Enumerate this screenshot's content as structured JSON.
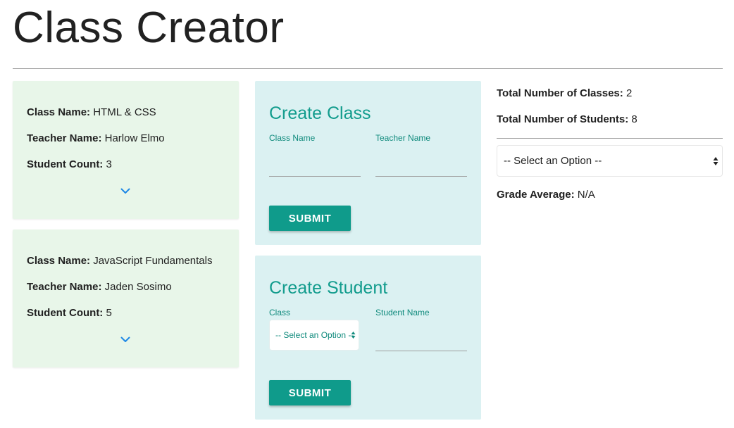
{
  "page": {
    "title": "Class Creator"
  },
  "classes": [
    {
      "name_label": "Class Name:",
      "name": "HTML & CSS",
      "teacher_label": "Teacher Name:",
      "teacher": "Harlow Elmo",
      "count_label": "Student Count:",
      "count": "3"
    },
    {
      "name_label": "Class Name:",
      "name": "JavaScript Fundamentals",
      "teacher_label": "Teacher Name:",
      "teacher": "Jaden Sosimo",
      "count_label": "Student Count:",
      "count": "5"
    }
  ],
  "create_class": {
    "title": "Create Class",
    "class_name_label": "Class Name",
    "class_name_value": "",
    "teacher_name_label": "Teacher Name",
    "teacher_name_value": "",
    "submit_label": "SUBMIT"
  },
  "create_student": {
    "title": "Create Student",
    "class_label": "Class",
    "class_select_value": "-- Select an Option --",
    "student_name_label": "Student Name",
    "student_name_value": "",
    "submit_label": "SUBMIT"
  },
  "stats": {
    "total_classes_label": "Total Number of Classes:",
    "total_classes": "2",
    "total_students_label": "Total Number of Students:",
    "total_students": "8",
    "select_value": "-- Select an Option --",
    "grade_average_label": "Grade Average:",
    "grade_average": "N/A"
  },
  "icons": {
    "expand": "chevron-down-icon",
    "select_arrows": "select-arrows-icon"
  },
  "colors": {
    "class_card_bg": "#e8f6e9",
    "form_card_bg": "#dbf1f2",
    "accent_teal": "#0f9b8b",
    "chevron_blue": "#1e88e5",
    "text": "#212121"
  }
}
